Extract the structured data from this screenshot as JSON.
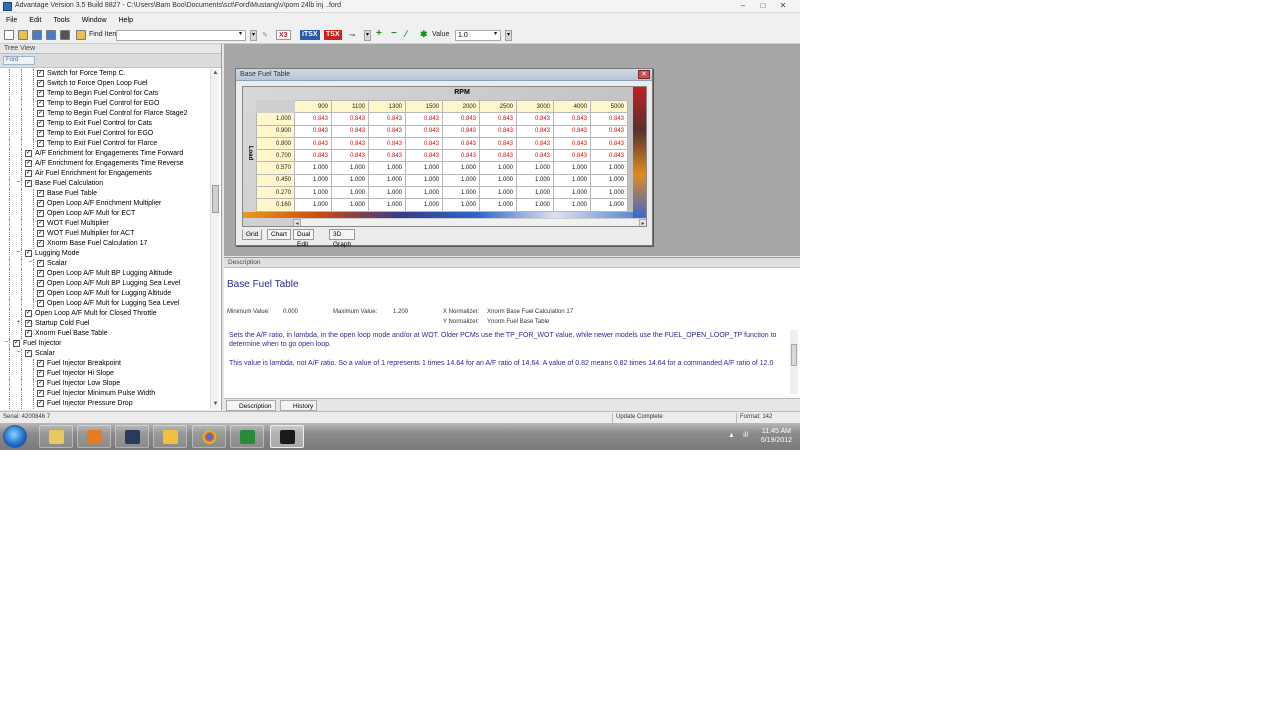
{
  "window": {
    "title": "Advantage Version 3.5 Build 8827 - C:\\Users\\Bam Boo\\Documents\\sct\\Ford\\Mustang\\v\\pom 24lb inj ..ford",
    "minimize": "–",
    "maximize": "□",
    "close": "✕"
  },
  "menu": [
    "File",
    "Edit",
    "Tools",
    "Window",
    "Help"
  ],
  "toolbar": {
    "find_label": "Find Item:",
    "find_value": "",
    "badge_x3": "X3",
    "badge_itsx": "iTSX",
    "badge_tsx": "TSX",
    "value_label": "Value",
    "value_field": "1.0",
    "colors": {
      "x3": "#cc2222",
      "itsx": "#2a5aa8",
      "tsx": "#cc2222"
    }
  },
  "tree": {
    "header": "Tree View",
    "tab": "Ford",
    "items": [
      {
        "label": "Switch for Force Temp C.",
        "depth": 3,
        "checked": true
      },
      {
        "label": "Switch to Force Open Loop Fuel",
        "depth": 3,
        "checked": true
      },
      {
        "label": "Temp to Begin Fuel Control for Cats",
        "depth": 3,
        "checked": true
      },
      {
        "label": "Temp to Begin Fuel Control for EGO",
        "depth": 3,
        "checked": true
      },
      {
        "label": "Temp to Begin Fuel Control for Flarce Stage2",
        "depth": 3,
        "checked": true
      },
      {
        "label": "Temp to Exit Fuel Control for Cats",
        "depth": 3,
        "checked": true
      },
      {
        "label": "Temp to Exit Fuel Control for EGO",
        "depth": 3,
        "checked": true
      },
      {
        "label": "Temp to Exit Fuel Control for Flarce",
        "depth": 3,
        "checked": true
      },
      {
        "label": "A/F Enrichment for Engagements Time Forward",
        "depth": 2,
        "checked": true
      },
      {
        "label": "A/F Enrichment for Engagements Time Reverse",
        "depth": 2,
        "checked": true
      },
      {
        "label": "Air Fuel Enrichment for Engagements",
        "depth": 2,
        "checked": true
      },
      {
        "label": "Base Fuel Calculation",
        "depth": 2,
        "checked": true,
        "expander": "−"
      },
      {
        "label": "Base Fuel Table",
        "depth": 3,
        "checked": true
      },
      {
        "label": "Open Loop A/F Enrichment Multiplier",
        "depth": 3,
        "checked": true
      },
      {
        "label": "Open Loop A/F Mult for ECT",
        "depth": 3,
        "checked": true
      },
      {
        "label": "WOT Fuel Multiplier",
        "depth": 3,
        "checked": true
      },
      {
        "label": "WOT Fuel Multiplier for ACT",
        "depth": 3,
        "checked": true
      },
      {
        "label": "Xnorm Base Fuel Calculation 17",
        "depth": 3,
        "checked": true
      },
      {
        "label": "Lugging Mode",
        "depth": 2,
        "checked": true,
        "expander": "−"
      },
      {
        "label": "Scalar",
        "depth": 3,
        "checked": true,
        "expander": "−"
      },
      {
        "label": "Open Loop A/F Mult BP Lugging Altitude",
        "depth": 3,
        "checked": true
      },
      {
        "label": "Open Loop A/F Mult BP Lugging Sea Level",
        "depth": 3,
        "checked": true
      },
      {
        "label": "Open Loop A/F Mult for Lugging Altitude",
        "depth": 3,
        "checked": true
      },
      {
        "label": "Open Loop A/F Mult for Lugging Sea Level",
        "depth": 3,
        "checked": true
      },
      {
        "label": "Open Loop A/F Mult for Closed Throttle",
        "depth": 2,
        "checked": true
      },
      {
        "label": "Startup Cold Fuel",
        "depth": 2,
        "checked": true,
        "expander": "+"
      },
      {
        "label": "Xnorm Fuel Base Table",
        "depth": 2,
        "checked": true
      },
      {
        "label": "Fuel Injector",
        "depth": 1,
        "checked": true,
        "expander": "−"
      },
      {
        "label": "Scalar",
        "depth": 2,
        "checked": true,
        "expander": "−"
      },
      {
        "label": "Fuel Injector Breakpoint",
        "depth": 3,
        "checked": true
      },
      {
        "label": "Fuel Injector Hi Slope",
        "depth": 3,
        "checked": true
      },
      {
        "label": "Fuel Injector Low Slope",
        "depth": 3,
        "checked": true
      },
      {
        "label": "Fuel Injector Minimum Pulse Width",
        "depth": 3,
        "checked": true
      },
      {
        "label": "Fuel Injector Pressure Drop",
        "depth": 3,
        "checked": true
      }
    ]
  },
  "table_window": {
    "title": "Base Fuel Table",
    "close": "✕",
    "col_axis_label": "RPM",
    "row_axis_label": "Load",
    "columns": [
      "900",
      "1100",
      "1300",
      "1500",
      "2000",
      "2500",
      "3000",
      "4000",
      "5000"
    ],
    "rows": [
      {
        "load": "1.000",
        "values": [
          "0.843",
          "0.843",
          "0.843",
          "0.843",
          "0.843",
          "0.843",
          "0.843",
          "0.843",
          "0.843"
        ],
        "highlight": true
      },
      {
        "load": "0.900",
        "values": [
          "0.843",
          "0.843",
          "0.843",
          "0.843",
          "0.843",
          "0.843",
          "0.843",
          "0.843",
          "0.843"
        ],
        "highlight": true
      },
      {
        "load": "0.800",
        "values": [
          "0.843",
          "0.843",
          "0.843",
          "0.843",
          "0.843",
          "0.843",
          "0.843",
          "0.843",
          "0.843"
        ],
        "highlight": true
      },
      {
        "load": "0.700",
        "values": [
          "0.843",
          "0.843",
          "0.843",
          "0.843",
          "0.843",
          "0.843",
          "0.843",
          "0.843",
          "0.843"
        ],
        "highlight": true
      },
      {
        "load": "0.570",
        "values": [
          "1.000",
          "1.000",
          "1.000",
          "1.000",
          "1.000",
          "1.000",
          "1.000",
          "1.000",
          "1.000"
        ],
        "highlight": false
      },
      {
        "load": "0.450",
        "values": [
          "1.000",
          "1.000",
          "1.000",
          "1.000",
          "1.000",
          "1.000",
          "1.000",
          "1.000",
          "1.000"
        ],
        "highlight": false
      },
      {
        "load": "0.270",
        "values": [
          "1.000",
          "1.000",
          "1.000",
          "1.000",
          "1.000",
          "1.000",
          "1.000",
          "1.000",
          "1.000"
        ],
        "highlight": false
      },
      {
        "load": "0.160",
        "values": [
          "1.000",
          "1.000",
          "1.000",
          "1.000",
          "1.000",
          "1.000",
          "1.000",
          "1.000",
          "1.000"
        ],
        "highlight": false
      }
    ],
    "tabs": [
      "Grid",
      "Chart",
      "Dual Edit",
      "3D Graph"
    ],
    "active_tab": "Grid",
    "colors": {
      "changed_value": "#d01010",
      "axis_cell": "#fff6cc"
    }
  },
  "description": {
    "header": "Description",
    "title": "Base Fuel Table",
    "min_label": "Minimum Value:",
    "min_value": "0.000",
    "max_label": "Maximum Value:",
    "max_value": "1.200",
    "x_norm_label": "X Normalizer:",
    "x_norm_value": "Xnorm Base Fuel Calculation 17",
    "y_norm_label": "Y Normalizer:",
    "y_norm_value": "Ynorm Fuel Base Table",
    "paragraph1": "Sets the A/F ratio, in lambda, in the open loop mode and/or at WOT. Older PCMs use the TP_FOR_WOT value, while newer models use the FUEL_OPEN_LOOP_TP function to determine when to go open loop.",
    "paragraph2": "This value is lambda, not A/F ratio. So a value of 1 represents 1 times 14.64 for an A/F ratio of 14.64. A value of 0.82 means 0.82 times 14.64 for a commanded A/F ratio of 12.0",
    "tabs": [
      "Description",
      "History"
    ]
  },
  "status": {
    "left": "Serial: 4200846 7",
    "middle": "Update Complete",
    "right": "Format: 142"
  },
  "taskbar": {
    "time": "11:45 AM",
    "date": "6/19/2012",
    "tray_arrow": "▲",
    "tray_signal": "ıll"
  }
}
